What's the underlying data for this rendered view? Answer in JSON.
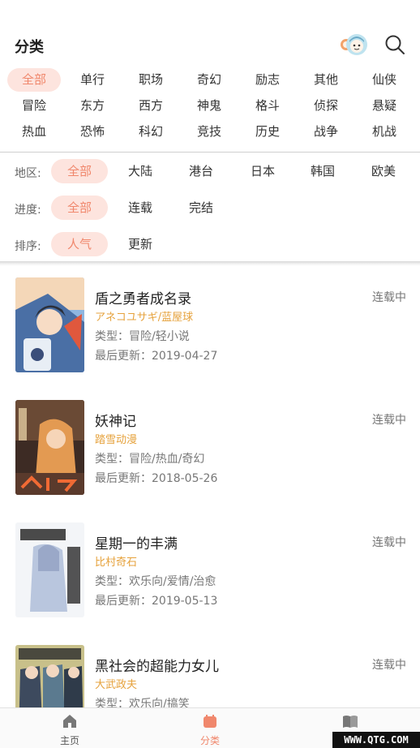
{
  "header": {
    "title": "分类"
  },
  "genres": [
    [
      "全部",
      "单行",
      "职场",
      "奇幻",
      "励志",
      "其他",
      "仙侠"
    ],
    [
      "冒险",
      "东方",
      "西方",
      "神鬼",
      "格斗",
      "侦探",
      "悬疑"
    ],
    [
      "热血",
      "恐怖",
      "科幻",
      "竞技",
      "历史",
      "战争",
      "机战"
    ]
  ],
  "filters": {
    "region": {
      "label": "地区:",
      "options": [
        "全部",
        "大陆",
        "港台",
        "日本",
        "韩国",
        "欧美"
      ],
      "selected": "全部"
    },
    "progress": {
      "label": "进度:",
      "options": [
        "全部",
        "连载",
        "完结"
      ],
      "selected": "全部"
    },
    "sort": {
      "label": "排序:",
      "options": [
        "人气",
        "更新"
      ],
      "selected": "人气"
    }
  },
  "comics": [
    {
      "title": "盾之勇者成名录",
      "author": "アネコユサギ/蓝屋球",
      "genre": "类型：冒险/轻小说",
      "updated": "最后更新：2019-04-27",
      "status": "连载中",
      "cover_color": "#7aa7d8"
    },
    {
      "title": "妖神记",
      "author": "踏雪动漫",
      "genre": "类型：冒险/热血/奇幻",
      "updated": "最后更新：2018-05-26",
      "status": "连载中",
      "cover_color": "#c9824a"
    },
    {
      "title": "星期一的丰满",
      "author": "比村奇石",
      "genre": "类型：欢乐向/爱情/治愈",
      "updated": "最后更新：2019-05-13",
      "status": "连载中",
      "cover_color": "#dfe6f0"
    },
    {
      "title": "黑社会的超能力女儿",
      "author": "大武政夫",
      "genre": "类型：欢乐向/搞笑",
      "updated": "",
      "status": "连载中",
      "cover_color": "#8a9c84"
    }
  ],
  "tabbar": {
    "tabs": [
      {
        "label": "主页",
        "icon": "home-icon"
      },
      {
        "label": "分类",
        "icon": "category-icon"
      },
      {
        "label": "",
        "icon": "book-icon"
      }
    ],
    "active": "分类"
  },
  "watermark": "WWW.QTG.COM",
  "colors": {
    "accent": "#f0876c",
    "accent_bg": "#fde4de",
    "author": "#e6a23c"
  }
}
